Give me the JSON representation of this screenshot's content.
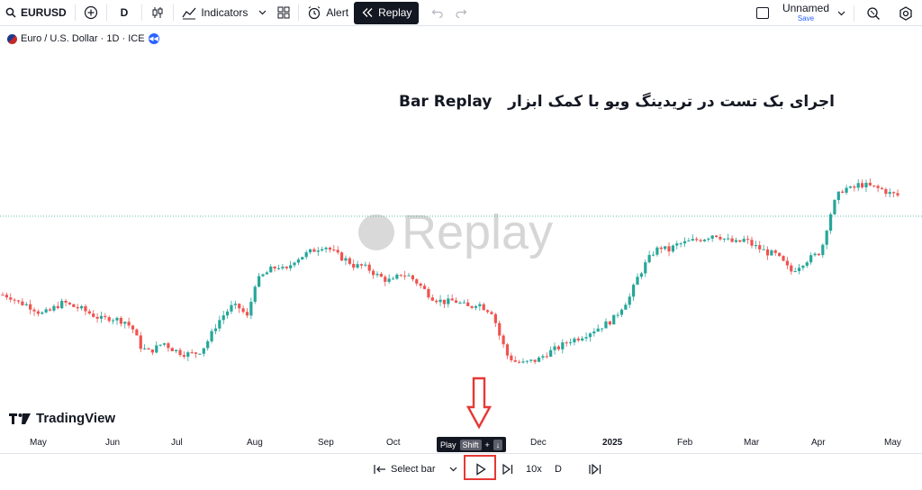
{
  "toolbar": {
    "symbol": "EURUSD",
    "interval": "D",
    "indicators_label": "Indicators",
    "alert_label": "Alert",
    "replay_label": "Replay",
    "layout_name": "Unnamed",
    "save_label": "Save"
  },
  "legend": {
    "title": "Euro / U.S. Dollar · 1D · ICE"
  },
  "headline": {
    "persian_text": "اجرای بک تست در تریدینگ ویو با کمک ابزار",
    "english_text": "Bar Replay"
  },
  "watermark": "Replay",
  "logo_text": "TradingView",
  "time_axis": {
    "labels": [
      "May",
      "Jun",
      "Jul",
      "Aug",
      "Sep",
      "Oct",
      "Dec",
      "2025",
      "Feb",
      "Mar",
      "Apr",
      "May"
    ]
  },
  "tooltip": {
    "label": "Play",
    "key1": "Shift",
    "plus": "+",
    "key2": "↓"
  },
  "replay_bar": {
    "select_bar_label": "Select bar",
    "speed_label": "10x",
    "interval_label": "D"
  },
  "chart_data": {
    "type": "candlestick",
    "trend_path": [
      0.4,
      0.39,
      0.36,
      0.35,
      0.33,
      0.3,
      0.31,
      0.34,
      0.36,
      0.34,
      0.33,
      0.31,
      0.29,
      0.27,
      0.28,
      0.27,
      0.26,
      0.22,
      0.13,
      0.1,
      0.12,
      0.15,
      0.12,
      0.1,
      0.09,
      0.09,
      0.11,
      0.17,
      0.25,
      0.3,
      0.34,
      0.33,
      0.28,
      0.46,
      0.5,
      0.53,
      0.55,
      0.52,
      0.58,
      0.6,
      0.62,
      0.64,
      0.66,
      0.63,
      0.6,
      0.58,
      0.55,
      0.55,
      0.53,
      0.5,
      0.48,
      0.47,
      0.51,
      0.5,
      0.47,
      0.43,
      0.39,
      0.37,
      0.36,
      0.37,
      0.35,
      0.33,
      0.36,
      0.33,
      0.31,
      0.18,
      0.08,
      0.05,
      0.04,
      0.05,
      0.06,
      0.09,
      0.11,
      0.13,
      0.16,
      0.17,
      0.19,
      0.21,
      0.23,
      0.25,
      0.28,
      0.34,
      0.39,
      0.49,
      0.56,
      0.62,
      0.65,
      0.63,
      0.66,
      0.67,
      0.68,
      0.69,
      0.7,
      0.72,
      0.7,
      0.68,
      0.67,
      0.69,
      0.66,
      0.64,
      0.62,
      0.61,
      0.57,
      0.52,
      0.55,
      0.58,
      0.6,
      0.63,
      0.8,
      0.91,
      0.96,
      0.95,
      0.98,
      0.97,
      0.96,
      0.95,
      0.93,
      0.92
    ]
  },
  "colors": {
    "up": "#26a69a",
    "down": "#ef5350",
    "accent": "#2962ff",
    "highlight": "#e53935"
  }
}
